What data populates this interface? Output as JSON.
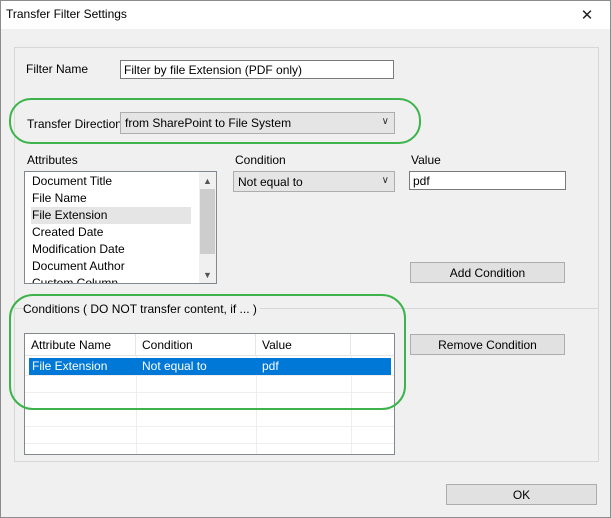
{
  "window": {
    "title": "Transfer Filter Settings",
    "close_glyph": "✕"
  },
  "filter_name": {
    "label": "Filter Name",
    "value": "Filter by file Extension (PDF only)"
  },
  "transfer_direction": {
    "label": "Transfer Direction",
    "value": "from SharePoint to File System"
  },
  "attributes": {
    "label": "Attributes",
    "items": [
      "Document Title",
      "File Name",
      "File Extension",
      "Created Date",
      "Modification Date",
      "Document Author",
      "Custom Column"
    ],
    "selected": "File Extension"
  },
  "condition": {
    "label": "Condition",
    "value": "Not equal to"
  },
  "value": {
    "label": "Value",
    "text": "pdf"
  },
  "buttons": {
    "add_condition": "Add Condition",
    "remove_condition": "Remove Condition",
    "ok": "OK"
  },
  "conditions": {
    "label": "Conditions ( DO NOT transfer content, if ... )",
    "columns": [
      "Attribute Name",
      "Condition",
      "Value"
    ],
    "rows": [
      {
        "attribute": "File Extension",
        "condition": "Not equal to",
        "value": "pdf"
      }
    ]
  },
  "icons": {
    "chevron": "chevron-down-icon",
    "close": "close-icon"
  },
  "colors": {
    "highlight_ellipse": "#3cb44b",
    "selection": "#0078d7"
  }
}
